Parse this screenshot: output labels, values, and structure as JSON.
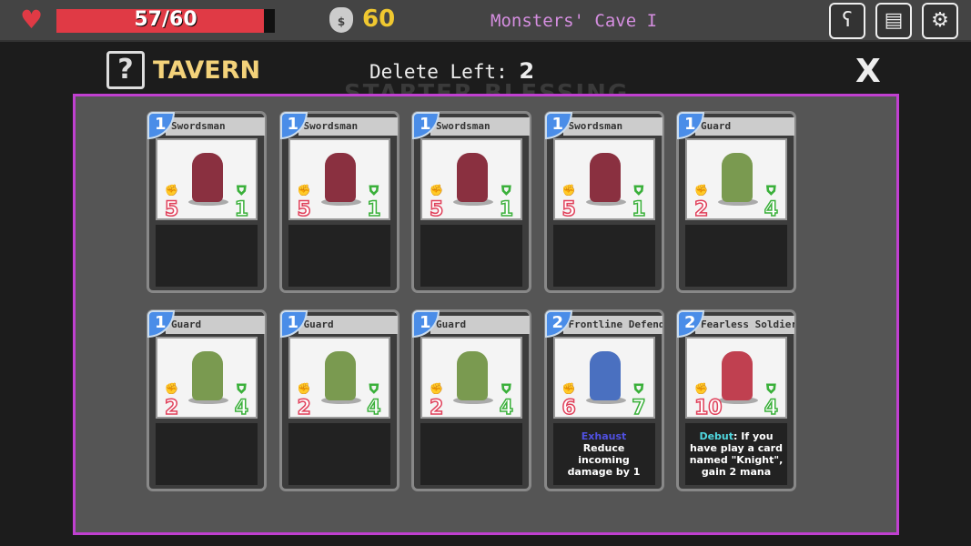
{
  "hud": {
    "hp": 57,
    "hp_max": 60,
    "hp_text": "57/60",
    "gold": "60",
    "location": "Monsters' Cave I",
    "buttons": [
      "ability-icon",
      "deck-icon",
      "gear-icon"
    ]
  },
  "header": {
    "help": "?",
    "title": "TAVERN",
    "delete_label": "Delete Left:",
    "delete_count": "2",
    "close": "X",
    "background_text": "STARTER BLESSING"
  },
  "colors": {
    "modal_border": "#c040d0",
    "cost": "#4a8de8",
    "attack": "#e0405a",
    "defense": "#3ab03a"
  },
  "cards": [
    {
      "cost": "1",
      "name": "Swordsman",
      "attack": "5",
      "defense": "1",
      "color": "#8a3040",
      "desc": []
    },
    {
      "cost": "1",
      "name": "Swordsman",
      "attack": "5",
      "defense": "1",
      "color": "#8a3040",
      "desc": []
    },
    {
      "cost": "1",
      "name": "Swordsman",
      "attack": "5",
      "defense": "1",
      "color": "#8a3040",
      "desc": []
    },
    {
      "cost": "1",
      "name": "Swordsman",
      "attack": "5",
      "defense": "1",
      "color": "#8a3040",
      "desc": []
    },
    {
      "cost": "1",
      "name": "Guard",
      "attack": "2",
      "defense": "4",
      "color": "#7a9a50",
      "desc": []
    },
    {
      "cost": "1",
      "name": "Guard",
      "attack": "2",
      "defense": "4",
      "color": "#7a9a50",
      "desc": []
    },
    {
      "cost": "1",
      "name": "Guard",
      "attack": "2",
      "defense": "4",
      "color": "#7a9a50",
      "desc": []
    },
    {
      "cost": "1",
      "name": "Guard",
      "attack": "2",
      "defense": "4",
      "color": "#7a9a50",
      "desc": []
    },
    {
      "cost": "2",
      "name": "Frontline Defender",
      "attack": "6",
      "defense": "7",
      "color": "#4a70c0",
      "keyword": "Exhaust",
      "keyword_class": "kw1",
      "text": "Reduce incoming damage by 1"
    },
    {
      "cost": "2",
      "name": "Fearless Soldier",
      "attack": "10",
      "defense": "4",
      "color": "#c04050",
      "keyword": "Debut",
      "keyword_class": "kw2",
      "text": ": If you have play a card named \"Knight\", gain 2 mana"
    }
  ]
}
